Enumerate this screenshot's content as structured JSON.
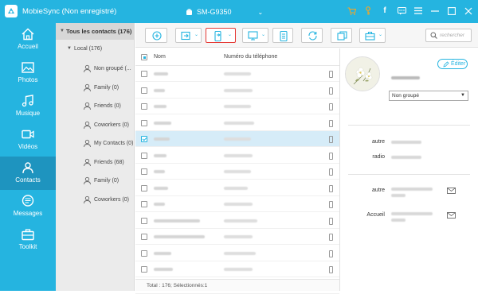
{
  "app": {
    "title": "MobieSync (Non enregistré)",
    "device_name": "SM-G9350"
  },
  "titlebar_icons": [
    "cart-icon",
    "key-icon",
    "facebook-icon",
    "chat-icon",
    "menu-icon",
    "minimize-icon",
    "maximize-icon",
    "close-icon"
  ],
  "nav": {
    "items": [
      {
        "label": "Accueil",
        "icon": "home-icon"
      },
      {
        "label": "Photos",
        "icon": "photo-icon"
      },
      {
        "label": "Musique",
        "icon": "music-icon"
      },
      {
        "label": "Vidéos",
        "icon": "video-icon"
      },
      {
        "label": "Contacts",
        "icon": "contacts-icon",
        "active": true
      },
      {
        "label": "Messages",
        "icon": "message-icon"
      },
      {
        "label": "Toolkit",
        "icon": "toolkit-icon"
      }
    ]
  },
  "tree": {
    "header": "Tous les contacts  (176)",
    "local": "Local  (176)",
    "groups": [
      {
        "label": "Non groupé  (..."
      },
      {
        "label": "Family  (0)"
      },
      {
        "label": "Friends  (0)"
      },
      {
        "label": "Coworkers  (0)"
      },
      {
        "label": "My Contacts  (0)"
      },
      {
        "label": "Friends  (68)"
      },
      {
        "label": "Family  (0)"
      },
      {
        "label": "Coworkers  (0)"
      }
    ]
  },
  "toolbar": {
    "buttons": [
      "add-button",
      "import-button",
      "export-to-device-button",
      "export-to-pc-button",
      "backup-button",
      "refresh-button",
      "duplicate-button",
      "toolbox-button"
    ],
    "search_placeholder": "rechercher"
  },
  "table": {
    "col_name": "Nom",
    "col_phone": "Numéro du téléphone",
    "selected_row": 4,
    "row_count": 14
  },
  "status": "Total : 176; Sélectionnés:1",
  "detail": {
    "edit_label": "Éditer",
    "group_value": "Non groupé",
    "phone_labels": [
      "autre",
      "radio"
    ],
    "email_labels": [
      "autre",
      "Accueil"
    ]
  },
  "colors": {
    "accent": "#25b4e0",
    "active_nav": "#1e94bf",
    "selection": "#d6ecf8",
    "highlight_border": "#e53935"
  }
}
